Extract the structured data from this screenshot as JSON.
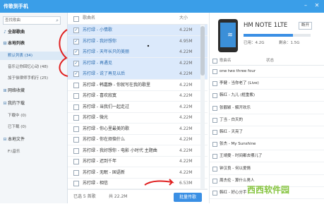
{
  "window": {
    "title": "传歌到手机",
    "minimize_label": "–",
    "close_label": "✕"
  },
  "sidebar": {
    "search_placeholder": "查找歌曲",
    "items": [
      {
        "label": "全部歌曲",
        "icon": "music-note-icon"
      },
      {
        "label": "本地列表",
        "icon": "minus-expand-icon"
      },
      {
        "label": "默认列表 (34)"
      },
      {
        "label": "音乐让你回忆心动 (48)"
      },
      {
        "label": "加于徐律师手机行 (25)"
      },
      {
        "label": "网络收藏",
        "icon": "plus-expand-icon"
      },
      {
        "label": "我的下载",
        "icon": "minus-expand-icon"
      },
      {
        "label": "下载中 (0)"
      },
      {
        "label": "已下载 (0)"
      },
      {
        "label": "本地文件",
        "icon": "minus-expand-icon"
      },
      {
        "label": "F:\\音乐"
      }
    ]
  },
  "song_list": {
    "header": {
      "name": "歌曲名",
      "size": "大小"
    },
    "rows": [
      {
        "title": "苏打绿 - 小情歌",
        "size": "4.22M",
        "checked": true
      },
      {
        "title": "苏打绿 - 我好想你",
        "size": "4.95M",
        "checked": true
      },
      {
        "title": "苏打绿 - 天年长只的美丽",
        "size": "4.22M",
        "checked": true
      },
      {
        "title": "苏打绿 - 再遇见",
        "size": "4.22M",
        "checked": true
      },
      {
        "title": "苏打绿 - 说了再见以后",
        "size": "4.22M",
        "checked": true
      },
      {
        "title": "苏打绿 - 韩嘉静 - 你就写在我的歌里",
        "size": "4.22M",
        "checked": false
      },
      {
        "title": "苏打绿 - 喜欢寂寞",
        "size": "4.22M",
        "checked": false
      },
      {
        "title": "苏打绿 - 当我们一起走过",
        "size": "4.22M",
        "checked": false
      },
      {
        "title": "苏打绿 - 微光",
        "size": "4.22M",
        "checked": false
      },
      {
        "title": "苏打绿 - 你心里最美的歌",
        "size": "4.22M",
        "checked": false
      },
      {
        "title": "苏打绿 - 你在烦恼什么",
        "size": "4.22M",
        "checked": false
      },
      {
        "title": "苏打绿 - 我好想你 - 电影 小时代 主题曲",
        "size": "4.22M",
        "checked": false
      },
      {
        "title": "苏打绿 - 迟到千年",
        "size": "4.22M",
        "checked": false
      },
      {
        "title": "苏打绿 - 无眠 - 国语新",
        "size": "4.22M",
        "checked": false
      },
      {
        "title": "苏打绿 - 相信",
        "size": "6.53M",
        "checked": false
      }
    ],
    "footer": {
      "selected_label": "已选 5 首歌",
      "total_label": "共 22.2M",
      "transfer_button": "批量传歌"
    }
  },
  "device": {
    "name": "HM NOTE 1LTE",
    "rename_button": "断开",
    "capacity": {
      "used_label": "已用：4.2G",
      "free_label": "剩余：1.5G",
      "used_fraction": 0.74
    },
    "list_header": {
      "name": "歌曲名",
      "status": "状态"
    },
    "songs": [
      "one two three four",
      "李健 - 当你老了 (Live)",
      "韩红 - 九儿 (框重紫)",
      "张靓颖 - 解开欢乐",
      "丁当 - 白天的",
      "韩红 - 天亮了",
      "张杰 - My Sunshine",
      "王靖雯 - 时间都去哪儿了",
      "钟汉良 - 何以爱情",
      "周杰伦 - 算什么男人",
      "韩红 - 好心分手"
    ]
  },
  "watermark": "西西软件园",
  "colors": {
    "accent": "#3a8fe4",
    "titlebar": "#3a9ee8",
    "selected_row": "#dbe9fb",
    "annotation": "#e02020"
  }
}
